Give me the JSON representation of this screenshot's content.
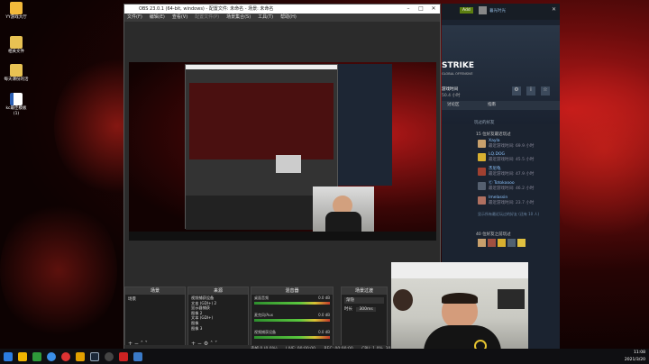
{
  "desktop": {
    "icons": [
      {
        "label": "YY游戏大厅",
        "icon": "yy-game-icon"
      },
      {
        "label": "相关文件",
        "icon": "folder-icon"
      },
      {
        "label": "每天课份的活",
        "icon": "folder-icon"
      },
      {
        "label": "kc最佳模板(1)",
        "icon": "word-document-icon"
      }
    ]
  },
  "obs": {
    "title": "OBS 23.0.1 (64-bit, windows) - 配置文件: 未命名 - 场景: 未命名",
    "menu": [
      "文件(F)",
      "编辑(E)",
      "查看(V)",
      "配置文件(P)",
      "场景集合(S)",
      "工具(T)",
      "帮助(H)"
    ],
    "docks": {
      "scenes": {
        "title": "场景",
        "items": [
          "场景"
        ]
      },
      "sources": {
        "title": "来源",
        "items": [
          "视频捕获设备",
          "文本 (GDI+) 2",
          "显示器捕获",
          "图像 2",
          "文本 (GDI+)",
          "图像",
          "图像 3"
        ]
      },
      "mixer": {
        "title": "混音器",
        "channels": [
          {
            "name": "桌面音频",
            "db": "0.0 dB"
          },
          {
            "name": "麦克风/Aux",
            "db": "0.0 dB"
          },
          {
            "name": "视频捕获设备",
            "db": "0.0 dB"
          }
        ]
      },
      "transitions": {
        "title": "场景过渡",
        "type": "渐隐",
        "duration_label": "时长",
        "duration": "300ms"
      }
    },
    "status": {
      "dropped": "丢帧 0 (0.0%)",
      "live": "LIVE: 00:00:00",
      "rec": "REC: 00:00:00",
      "cpu": "CPU: 1.0%, 30.00 fps"
    }
  },
  "steam": {
    "user": "暮光时光",
    "points_btn": "Add",
    "game_banner": "STRIKE",
    "game_sub": "GLOBAL OFFENSIVE",
    "play_time": "游戏时间",
    "hours": "50.4 小时",
    "tabs": [
      "讨论区",
      "指南"
    ],
    "recent_title": "玩过的好友",
    "recent_count": "15 位好友最近玩过",
    "friends": [
      {
        "name": "Xayla",
        "status": "最近游戏时间: 69.9 小时"
      },
      {
        "name": "LQ.DOG",
        "status": "最近游戏时间: 45.5 小时"
      },
      {
        "name": "杰尼龟",
        "status": "最近游戏时间: 47.9 小时"
      },
      {
        "name": "Ⓒ Totokoooo",
        "status": "最近游戏时间: 46.2 小时"
      },
      {
        "name": "Imelassin",
        "status": "最近游戏时间: 23.7 小时"
      }
    ],
    "more_friends": "显示所有最近玩过的好友 (还有 10 人)",
    "previous_count": "40 位好友之前玩过"
  },
  "taskbar": {
    "time": "11:08",
    "date": "2021/3/20"
  }
}
